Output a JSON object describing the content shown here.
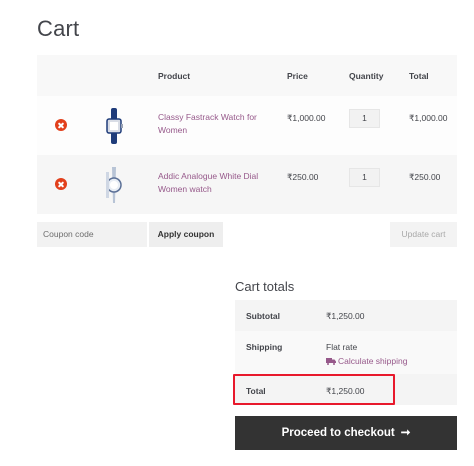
{
  "page": {
    "title": "Cart"
  },
  "cart": {
    "headers": {
      "product": "Product",
      "price": "Price",
      "quantity": "Quantity",
      "total": "Total"
    },
    "items": [
      {
        "name": "Classy Fastrack Watch for Women",
        "price": "₹1,000.00",
        "quantity": "1",
        "total": "₹1,000.00",
        "thumb_icon": "watch-blue-strap"
      },
      {
        "name": "Addic Analogue White Dial Women watch",
        "price": "₹250.00",
        "quantity": "1",
        "total": "₹250.00",
        "thumb_icon": "watch-silver-bracelet"
      }
    ],
    "coupon_placeholder": "Coupon code",
    "apply_coupon_label": "Apply coupon",
    "update_cart_label": "Update cart"
  },
  "totals": {
    "title": "Cart totals",
    "subtotal_label": "Subtotal",
    "subtotal_value": "₹1,250.00",
    "shipping_label": "Shipping",
    "shipping_method": "Flat rate",
    "calculate_shipping": "Calculate shipping",
    "total_label": "Total",
    "total_value": "₹1,250.00"
  },
  "checkout": {
    "label": "Proceed to checkout"
  },
  "colors": {
    "accent": "#96588a",
    "remove": "#e2401c",
    "highlight": "#e8192c",
    "button_dark": "#333333"
  }
}
